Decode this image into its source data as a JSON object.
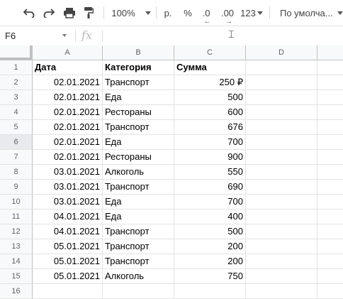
{
  "toolbar": {
    "undo_icon": "undo-icon",
    "redo_icon": "redo-icon",
    "print_icon": "print-icon",
    "paint_format_icon": "paint-format-icon",
    "zoom": "100%",
    "currency_label": "р.",
    "percent_label": "%",
    "decrease_decimal_label": ".0",
    "increase_decimal_label": ".00",
    "number_format_label": "123",
    "font_label": "По умолча..."
  },
  "formula_bar": {
    "cell_ref": "F6",
    "fx_label": "fx",
    "content": ""
  },
  "grid": {
    "columns": [
      "A",
      "B",
      "C",
      "D"
    ],
    "rows": [
      {
        "n": "1",
        "a": "Дата",
        "b": "Категория",
        "c": "Сумма"
      },
      {
        "n": "2",
        "a": "02.01.2021",
        "b": "Транспорт",
        "c": "250 ₽"
      },
      {
        "n": "3",
        "a": "02.01.2021",
        "b": "Еда",
        "c": "500"
      },
      {
        "n": "4",
        "a": "02.01.2021",
        "b": "Рестораны",
        "c": "600"
      },
      {
        "n": "5",
        "a": "02.01.2021",
        "b": "Транспорт",
        "c": "676"
      },
      {
        "n": "6",
        "a": "02.01.2021",
        "b": "Еда",
        "c": "700"
      },
      {
        "n": "7",
        "a": "02.01.2021",
        "b": "Рестораны",
        "c": "900"
      },
      {
        "n": "8",
        "a": "03.01.2021",
        "b": "Алкоголь",
        "c": "550"
      },
      {
        "n": "9",
        "a": "03.01.2021",
        "b": "Транспорт",
        "c": "690"
      },
      {
        "n": "10",
        "a": "03.01.2021",
        "b": "Еда",
        "c": "700"
      },
      {
        "n": "11",
        "a": "04.01.2021",
        "b": "Еда",
        "c": "400"
      },
      {
        "n": "12",
        "a": "04.01.2021",
        "b": "Транспорт",
        "c": "500"
      },
      {
        "n": "13",
        "a": "05.01.2021",
        "b": "Транспорт",
        "c": "200"
      },
      {
        "n": "14",
        "a": "05.01.2021",
        "b": "Транспорт",
        "c": "200"
      },
      {
        "n": "15",
        "a": "05.01.2021",
        "b": "Алкоголь",
        "c": "750"
      },
      {
        "n": "16",
        "a": "",
        "b": "",
        "c": ""
      }
    ],
    "selected_row": "6"
  }
}
